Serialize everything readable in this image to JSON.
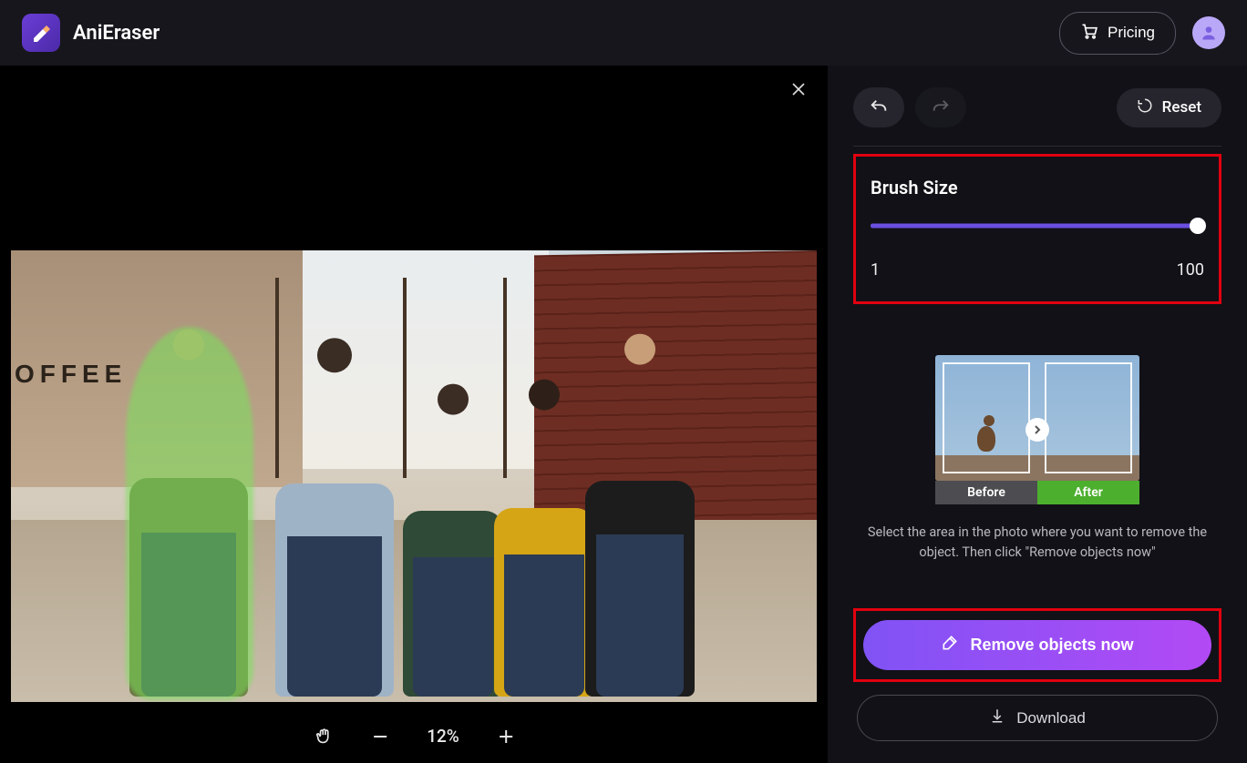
{
  "app": {
    "name": "AniEraser"
  },
  "header": {
    "pricing_label": "Pricing"
  },
  "canvas": {
    "coffee_sign": "OFFEE",
    "zoom_percent": "12%"
  },
  "sidebar": {
    "reset_label": "Reset",
    "brush": {
      "title": "Brush Size",
      "min": "1",
      "max": "100"
    },
    "example": {
      "before_label": "Before",
      "after_label": "After"
    },
    "help_text": "Select the area in the photo where you want to remove the object. Then click \"Remove objects now\"",
    "remove_label": "Remove objects now",
    "download_label": "Download"
  }
}
